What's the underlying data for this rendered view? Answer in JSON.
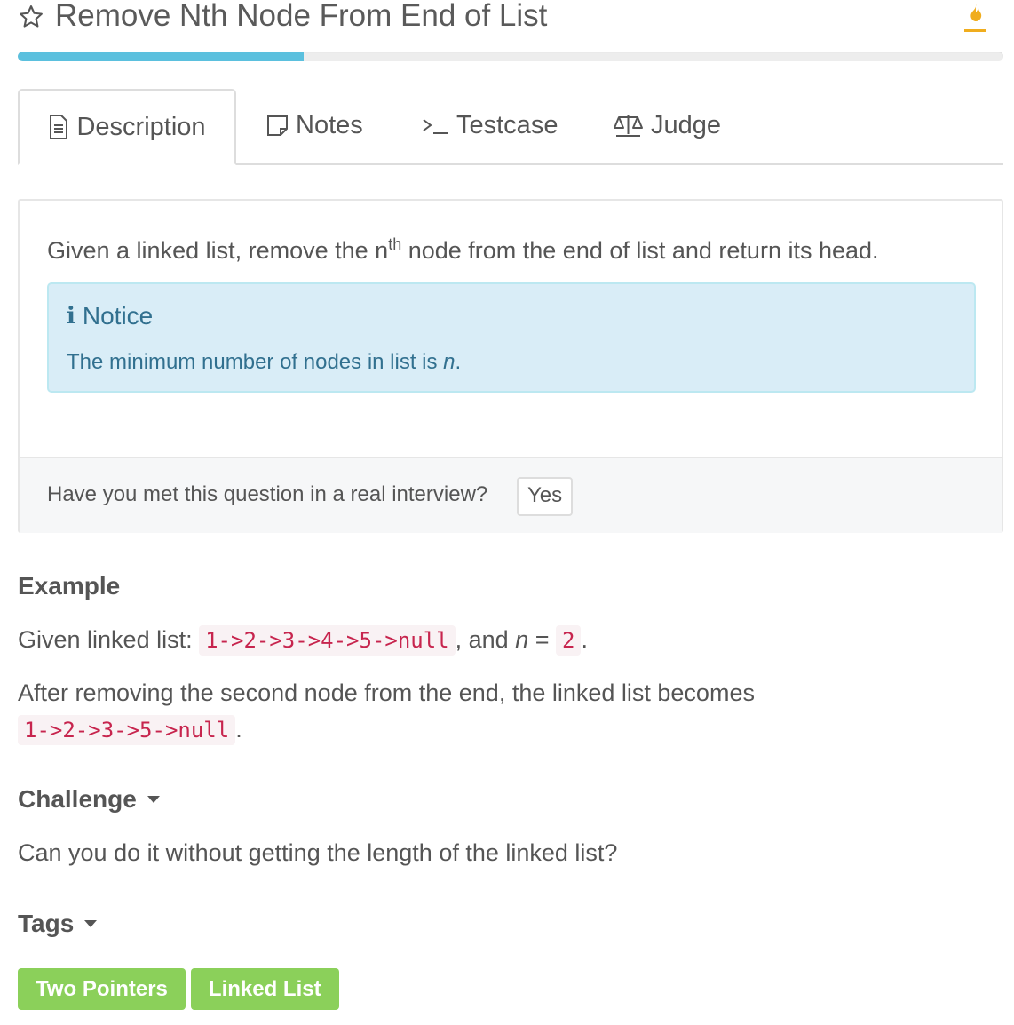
{
  "header": {
    "title": "Remove Nth Node From End of List",
    "star_icon": "star-outline-icon",
    "flame_icon": "flame-icon",
    "progress_percent": 29
  },
  "tabs": [
    {
      "label": "Description",
      "icon": "document-icon",
      "active": true
    },
    {
      "label": "Notes",
      "icon": "note-icon",
      "active": false
    },
    {
      "label": "Testcase",
      "icon": "terminal-icon",
      "active": false
    },
    {
      "label": "Judge",
      "icon": "scale-icon",
      "active": false
    }
  ],
  "description": {
    "text_before": "Given a linked list, remove the n",
    "sup": "th",
    "text_after": " node from the end of list and return its head."
  },
  "notice": {
    "title": "Notice",
    "body_before": "The minimum number of nodes in list is ",
    "body_var": "n",
    "body_after": "."
  },
  "interview": {
    "question": "Have you met this question in a real interview?",
    "yes_label": "Yes"
  },
  "example": {
    "heading": "Example",
    "line1_prefix": "Given linked list: ",
    "line1_code": "1->2->3->4->5->null",
    "line1_mid": ", and ",
    "line1_var": "n",
    "line1_eq": " = ",
    "line1_value": "2",
    "line1_end": ".",
    "line2_text": "After removing the second node from the end, the linked list becomes",
    "line3_code": "1->2->3->5->null",
    "line3_end": "."
  },
  "challenge": {
    "heading": "Challenge",
    "text": "Can you do it without getting the length of the linked list?"
  },
  "tags": {
    "heading": "Tags",
    "items": [
      "Two Pointers",
      "Linked List"
    ],
    "color": "#8bd05a"
  },
  "colors": {
    "progress": "#5bc0de",
    "notice_bg": "#d9edf7",
    "notice_text": "#31708f",
    "code_text": "#c7254e"
  }
}
